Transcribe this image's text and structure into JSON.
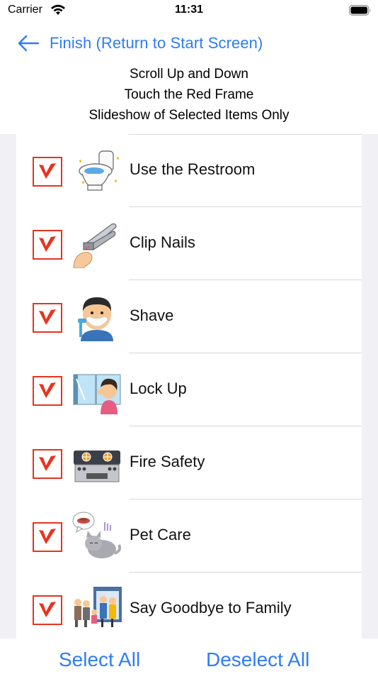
{
  "status_bar": {
    "carrier": "Carrier",
    "time": "11:31"
  },
  "nav": {
    "back_label": "Finish (Return to Start Screen)"
  },
  "instructions": [
    "Scroll Up and Down",
    "Touch the Red Frame",
    "Slideshow of Selected Items Only"
  ],
  "items": [
    {
      "label": "Use the Restroom",
      "icon": "toilet-icon",
      "checked": true
    },
    {
      "label": "Clip Nails",
      "icon": "nail-clipper-icon",
      "checked": true
    },
    {
      "label": "Shave",
      "icon": "shaving-man-icon",
      "checked": true
    },
    {
      "label": "Lock Up",
      "icon": "lock-window-icon",
      "checked": true
    },
    {
      "label": "Fire Safety",
      "icon": "gas-stove-icon",
      "checked": true
    },
    {
      "label": "Pet Care",
      "icon": "cat-with-bowl-icon",
      "checked": true
    },
    {
      "label": "Say Goodbye to Family",
      "icon": "family-icon",
      "checked": true
    }
  ],
  "bottom": {
    "select_all": "Select All",
    "deselect_all": "Deselect All"
  },
  "colors": {
    "accent": "#2f7cf6",
    "checkbox_red": "#e8331f",
    "background": "#f0f0f5"
  }
}
